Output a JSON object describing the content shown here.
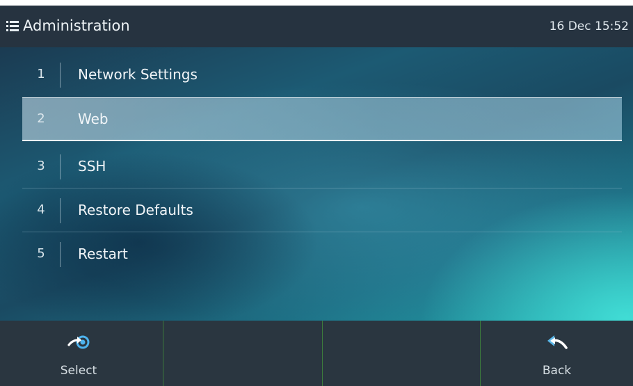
{
  "header": {
    "menu_icon": "menu-icon",
    "title": "Administration",
    "datetime": "16 Dec 15:52"
  },
  "menu": {
    "selected_index": 1,
    "items": [
      {
        "number": "1",
        "label": "Network Settings"
      },
      {
        "number": "2",
        "label": "Web"
      },
      {
        "number": "3",
        "label": "SSH"
      },
      {
        "number": "4",
        "label": "Restore Defaults"
      },
      {
        "number": "5",
        "label": "Restart"
      }
    ]
  },
  "softkeys": [
    {
      "label": "Select",
      "icon": "select-arrow-icon"
    },
    {
      "label": "",
      "icon": ""
    },
    {
      "label": "",
      "icon": ""
    },
    {
      "label": "Back",
      "icon": "back-arrow-icon"
    }
  ],
  "colors": {
    "header_bg": "#263340",
    "softkey_bg": "#2a3640",
    "accent": "#2aa6c8",
    "softkey_separator": "#3c7a3c"
  }
}
